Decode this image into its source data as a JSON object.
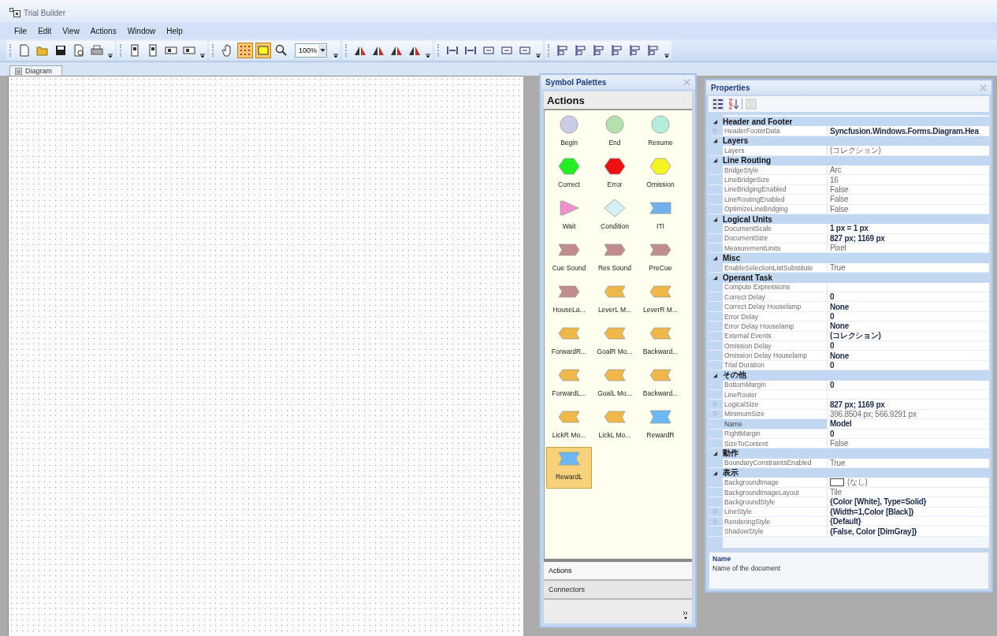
{
  "window": {
    "title": "Trial Builder"
  },
  "menu": [
    "File",
    "Edit",
    "View",
    "Actions",
    "Window",
    "Help"
  ],
  "toolbar_groups": [
    {
      "tools": [
        {
          "kind": "new-file",
          "on": false
        },
        {
          "kind": "open-folder",
          "on": false
        },
        {
          "kind": "save",
          "on": false
        },
        {
          "kind": "print-preview",
          "on": false
        },
        {
          "kind": "printer",
          "on": false
        }
      ]
    },
    {
      "tools": [
        {
          "kind": "arrange",
          "on": false
        },
        {
          "kind": "arrange",
          "on": false
        },
        {
          "kind": "arrange-wide",
          "on": false
        },
        {
          "kind": "arrange-wide",
          "on": false
        }
      ]
    },
    {
      "tools": [
        {
          "kind": "hand",
          "on": false
        },
        {
          "kind": "grid",
          "on": true
        },
        {
          "kind": "frame",
          "on": true
        },
        {
          "kind": "magnifier",
          "on": false
        },
        {
          "kind": "zoom-combo",
          "on": false,
          "value": "100%"
        }
      ]
    },
    {
      "tools": [
        {
          "kind": "flip",
          "on": false
        },
        {
          "kind": "flip",
          "on": false
        },
        {
          "kind": "flip",
          "on": false
        },
        {
          "kind": "flip",
          "on": false
        }
      ]
    },
    {
      "tools": [
        {
          "kind": "distribute",
          "on": false
        },
        {
          "kind": "distribute",
          "on": false
        },
        {
          "kind": "resize",
          "on": false
        },
        {
          "kind": "resize",
          "on": false
        },
        {
          "kind": "resize",
          "on": false
        }
      ]
    },
    {
      "tools": [
        {
          "kind": "align",
          "on": false
        },
        {
          "kind": "align",
          "on": false
        },
        {
          "kind": "align",
          "on": false
        },
        {
          "kind": "align",
          "on": false
        },
        {
          "kind": "align",
          "on": false
        },
        {
          "kind": "align",
          "on": false
        }
      ]
    }
  ],
  "document_tabs": [
    {
      "label": "Diagram",
      "selected": true
    }
  ],
  "symbol_palettes": {
    "title": "Symbol Palettes",
    "palette_title": "Actions",
    "symbols": [
      {
        "label": "Begin",
        "kind": "circle",
        "color": "#c8cce6",
        "selected": false
      },
      {
        "label": "End",
        "kind": "circle",
        "color": "#b4e0ae",
        "selected": false
      },
      {
        "label": "Resume",
        "kind": "circle",
        "color": "#b6ecdc",
        "selected": false
      },
      {
        "label": "Correct",
        "kind": "hexagon",
        "color": "#22ee22",
        "selected": false
      },
      {
        "label": "Error",
        "kind": "hexagon",
        "color": "#ee1111",
        "selected": false
      },
      {
        "label": "Omission",
        "kind": "hexagon",
        "color": "#f4f422",
        "selected": false
      },
      {
        "label": "Wait",
        "kind": "triangle",
        "color": "#f090c8",
        "selected": false
      },
      {
        "label": "Condition",
        "kind": "diamond",
        "color": "#d2f2f8",
        "selected": false
      },
      {
        "label": "ITI",
        "kind": "flag",
        "color": "#70b0ee",
        "selected": false
      },
      {
        "label": "Cue Sound",
        "kind": "arrow-right",
        "color": "#c08c8c",
        "selected": false
      },
      {
        "label": "Res Sound",
        "kind": "arrow-right",
        "color": "#c08c8c",
        "selected": false
      },
      {
        "label": "PreCue",
        "kind": "arrow-right",
        "color": "#c08c8c",
        "selected": false
      },
      {
        "label": "HouseLa...",
        "kind": "arrow-right",
        "color": "#c08c8c",
        "selected": false
      },
      {
        "label": "LeverL M...",
        "kind": "arrow-left",
        "color": "#f0b848",
        "selected": false
      },
      {
        "label": "LeverR M...",
        "kind": "arrow-left",
        "color": "#f0b848",
        "selected": false
      },
      {
        "label": "ForwardR...",
        "kind": "arrow-left",
        "color": "#f0b848",
        "selected": false
      },
      {
        "label": "GoalR Mo...",
        "kind": "arrow-left",
        "color": "#f0b848",
        "selected": false
      },
      {
        "label": "Backward...",
        "kind": "arrow-left",
        "color": "#f0b848",
        "selected": false
      },
      {
        "label": "ForwardL...",
        "kind": "arrow-left",
        "color": "#f0b848",
        "selected": false
      },
      {
        "label": "GoalL Mo...",
        "kind": "arrow-left",
        "color": "#f0b848",
        "selected": false
      },
      {
        "label": "Backward...",
        "kind": "arrow-left",
        "color": "#f0b848",
        "selected": false
      },
      {
        "label": "LickR Mo...",
        "kind": "arrow-left",
        "color": "#f0b848",
        "selected": false
      },
      {
        "label": "LickL Mo...",
        "kind": "arrow-left",
        "color": "#f0b848",
        "selected": false
      },
      {
        "label": "RewardR",
        "kind": "bowtie",
        "color": "#6cb8f2",
        "selected": false
      },
      {
        "label": "RewardL",
        "kind": "bowtie",
        "color": "#6cb8f2",
        "selected": true
      }
    ],
    "tabs": [
      {
        "label": "Actions",
        "selected": true
      },
      {
        "label": "Connectors",
        "selected": false
      }
    ]
  },
  "properties": {
    "title": "Properties",
    "categories": [
      {
        "name": "Header and Footer",
        "expanded": true,
        "rows": [
          {
            "name": "HeaderFooterData",
            "value": "Syncfusion.Windows.Forms.Diagram.Hea",
            "bold": true,
            "expandable": true,
            "selected": false,
            "swatch": false
          }
        ]
      },
      {
        "name": "Layers",
        "expanded": true,
        "rows": [
          {
            "name": "Layers",
            "value": "(コレクション)",
            "bold": false,
            "expandable": false,
            "selected": false,
            "swatch": false
          }
        ]
      },
      {
        "name": "Line Routing",
        "expanded": true,
        "rows": [
          {
            "name": "BridgeStyle",
            "value": "Arc",
            "bold": false,
            "expandable": false,
            "selected": false,
            "swatch": false
          },
          {
            "name": "LineBridgeSize",
            "value": "16",
            "bold": false,
            "expandable": false,
            "selected": false,
            "swatch": false
          },
          {
            "name": "LineBridgingEnabled",
            "value": "False",
            "bold": false,
            "expandable": false,
            "selected": false,
            "swatch": false
          },
          {
            "name": "LineRoutingEnabled",
            "value": "False",
            "bold": false,
            "expandable": false,
            "selected": false,
            "swatch": false
          },
          {
            "name": "OptimizeLineBridging",
            "value": "False",
            "bold": false,
            "expandable": false,
            "selected": false,
            "swatch": false
          }
        ]
      },
      {
        "name": "Logical Units",
        "expanded": true,
        "rows": [
          {
            "name": "DocumentScale",
            "value": "1 px = 1 px",
            "bold": true,
            "expandable": false,
            "selected": false,
            "swatch": false
          },
          {
            "name": "DocumentSize",
            "value": "827 px; 1169 px",
            "bold": true,
            "expandable": false,
            "selected": false,
            "swatch": false
          },
          {
            "name": "MeasurementUnits",
            "value": "Pixel",
            "bold": false,
            "expandable": false,
            "selected": false,
            "swatch": false
          }
        ]
      },
      {
        "name": "Misc",
        "expanded": true,
        "rows": [
          {
            "name": "EnableSelectionListSubstitute",
            "value": "True",
            "bold": false,
            "expandable": false,
            "selected": false,
            "swatch": false
          }
        ]
      },
      {
        "name": "Operant Task",
        "expanded": true,
        "rows": [
          {
            "name": "Compute Expressions",
            "expandable": false,
            "selected": false,
            "swatch": false
          },
          {
            "name": "Correct Delay",
            "value": "0",
            "bold": true,
            "expandable": false,
            "selected": false,
            "swatch": false
          },
          {
            "name": "Correct Delay Houselamp",
            "value": "None",
            "bold": true,
            "expandable": false,
            "selected": false,
            "swatch": false
          },
          {
            "name": "Error Delay",
            "value": "0",
            "bold": true,
            "expandable": false,
            "selected": false,
            "swatch": false
          },
          {
            "name": "Error Delay Houselamp",
            "value": "None",
            "bold": true,
            "expandable": false,
            "selected": false,
            "swatch": false
          },
          {
            "name": "External Events",
            "value": "(コレクション)",
            "bold": true,
            "expandable": false,
            "selected": false,
            "swatch": false
          },
          {
            "name": "Omission Delay",
            "value": "0",
            "bold": true,
            "expandable": false,
            "selected": false,
            "swatch": false
          },
          {
            "name": "Omission Delay Houselamp",
            "value": "None",
            "bold": true,
            "expandable": false,
            "selected": false,
            "swatch": false
          },
          {
            "name": "Trial Duration",
            "value": "0",
            "bold": true,
            "expandable": false,
            "selected": false,
            "swatch": false
          }
        ]
      },
      {
        "name": "その他",
        "expanded": true,
        "rows": [
          {
            "name": "BottomMargin",
            "value": "0",
            "bold": true,
            "expandable": false,
            "selected": false,
            "swatch": false
          },
          {
            "name": "LineRouter",
            "expandable": false,
            "selected": false,
            "swatch": false
          },
          {
            "name": "LogicalSize",
            "value": "827 px; 1169 px",
            "bold": true,
            "expandable": true,
            "selected": false,
            "swatch": false
          },
          {
            "name": "MinimumSize",
            "value": "396.8504 px; 566.9291 px",
            "bold": false,
            "expandable": true,
            "selected": false,
            "swatch": false
          },
          {
            "name": "Name",
            "value": "Model",
            "bold": true,
            "expandable": false,
            "selected": true,
            "swatch": false
          },
          {
            "name": "RightMargin",
            "value": "0",
            "bold": true,
            "expandable": false,
            "selected": false,
            "swatch": false
          },
          {
            "name": "SizeToContent",
            "value": "False",
            "bold": false,
            "expandable": false,
            "selected": false,
            "swatch": false
          }
        ]
      },
      {
        "name": "動作",
        "expanded": true,
        "rows": [
          {
            "name": "BoundaryConstraintsEnabled",
            "value": "True",
            "bold": false,
            "expandable": false,
            "selected": false,
            "swatch": false
          }
        ]
      },
      {
        "name": "表示",
        "expanded": true,
        "rows": [
          {
            "name": "BackgroundImage",
            "value": "(なし)",
            "bold": false,
            "expandable": false,
            "selected": false,
            "swatch": true
          },
          {
            "name": "BackgroundImageLayout",
            "value": "Tile",
            "bold": false,
            "expandable": false,
            "selected": false,
            "swatch": false
          },
          {
            "name": "BackgroundStyle",
            "value": "{Color [White], Type=Solid}",
            "bold": true,
            "expandable": false,
            "selected": false,
            "swatch": false
          },
          {
            "name": "LineStyle",
            "value": "{Width=1,Color [Black]}",
            "bold": true,
            "expandable": true,
            "selected": false,
            "swatch": false
          },
          {
            "name": "RenderingStyle",
            "value": "{Default}",
            "bold": true,
            "expandable": true,
            "selected": false,
            "swatch": false
          },
          {
            "name": "ShadowStyle",
            "value": "{False, Color [DimGray]}",
            "bold": true,
            "expandable": false,
            "selected": false,
            "swatch": false
          }
        ]
      }
    ],
    "description": {
      "title": "Name",
      "text": "Name of the document"
    }
  }
}
